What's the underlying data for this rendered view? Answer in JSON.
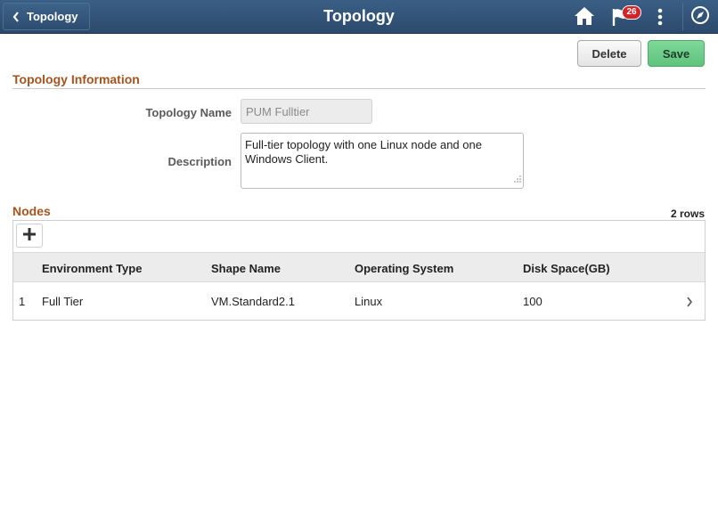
{
  "header": {
    "back_label": "Topology",
    "title": "Topology",
    "notification_count": "26",
    "icons": [
      "chevron-left-icon",
      "home-icon",
      "flag-icon",
      "more-vertical-icon",
      "compass-icon"
    ],
    "colors": {
      "bar": "#2c4a6b",
      "badge": "#d2232a"
    }
  },
  "toolbar": {
    "delete_label": "Delete",
    "save_label": "Save",
    "save_color": "#5fc37c"
  },
  "topology_info": {
    "section_title": "Topology Information",
    "name_label": "Topology Name",
    "name_value": "PUM Fulltier",
    "description_label": "Description",
    "description_value": "Full-tier topology with one Linux node and one Windows Client."
  },
  "nodes": {
    "section_title": "Nodes",
    "row_count": "2 rows",
    "columns": [
      "Environment Type",
      "Shape Name",
      "Operating System",
      "Disk Space(GB)"
    ],
    "rows": [
      {
        "index": "1",
        "environment_type": "Full Tier",
        "shape_name": "VM.Standard2.1",
        "operating_system": "Linux",
        "disk_space": "100"
      }
    ]
  },
  "accent_color": "#a4541f"
}
